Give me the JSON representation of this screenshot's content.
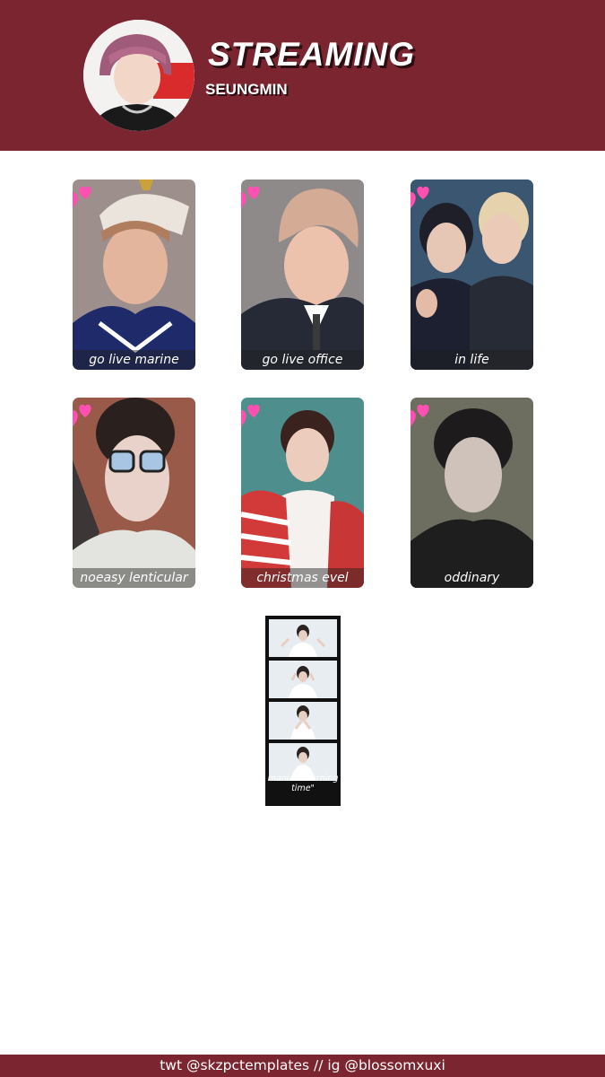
{
  "header": {
    "title": "STREAMING",
    "subtitle": "SEUNGMIN"
  },
  "colors": {
    "header_bg": "#7a2530",
    "heart": "#ff4fb0"
  },
  "cards": [
    {
      "label": "go live marine"
    },
    {
      "label": "go live office"
    },
    {
      "label": "in life"
    },
    {
      "label": "noeasy lenticular"
    },
    {
      "label": "christmas evel"
    },
    {
      "label": "oddinary"
    }
  ],
  "filmstrip": {
    "label": "maniac \"burning time\""
  },
  "footer": {
    "credit": "twt @skzpctemplates // ig @blossomxuxi"
  }
}
